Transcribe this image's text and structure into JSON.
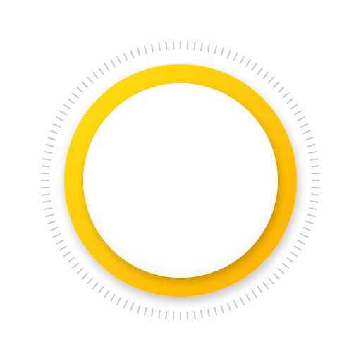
{
  "dial": {
    "tick_count": 120,
    "tick_color": "#c9c9c9",
    "ring_gradient_start": "#ffe012",
    "ring_gradient_end": "#ffb000",
    "face_color": "#ffffff",
    "face_shadow_color": "#d9d9d9",
    "icon": "sun-dial-icon"
  }
}
